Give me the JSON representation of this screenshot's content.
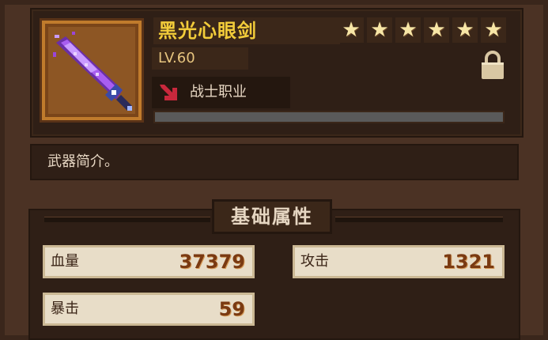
{
  "item": {
    "name": "黑光心眼剑",
    "level": "LV.60",
    "job": "战士职业",
    "stars": [
      "★",
      "★",
      "★",
      "★",
      "★",
      "★"
    ],
    "exp_fraction": 1.0
  },
  "description": "武器简介。",
  "section_title": "基础属性",
  "stats": [
    {
      "label": "血量",
      "value": "37379"
    },
    {
      "label": "攻击",
      "value": "1321"
    },
    {
      "label": "暴击",
      "value": "59"
    }
  ],
  "icons": {
    "weapon": "purple-sword-icon",
    "lock": "lock-icon",
    "job": "red-arrow-icon",
    "star": "star-icon"
  },
  "colors": {
    "name": "#f2cc3a",
    "weapon_purple": "#9a45d9",
    "value": "#7a3a12"
  }
}
